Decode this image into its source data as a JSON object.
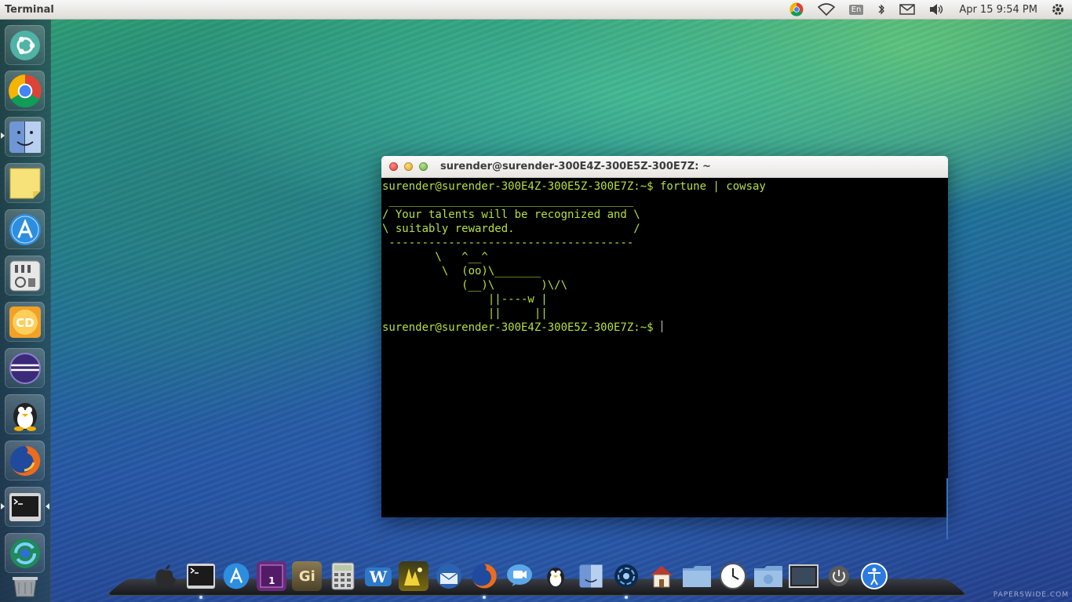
{
  "top_panel": {
    "app_title": "Terminal",
    "keyboard_layout": "En",
    "clock": "Apr 15  9:54 PM",
    "indicators": [
      "chrome-icon",
      "wifi-icon",
      "keyboard-layout",
      "bluetooth-icon",
      "mail-icon",
      "volume-icon",
      "clock",
      "power-gear-icon"
    ]
  },
  "launcher": {
    "items": [
      "ubuntu-dash",
      "google-chrome",
      "finder",
      "sticky-notes",
      "app-store",
      "system-settings",
      "cd-burner",
      "eclipse",
      "penguin-app",
      "firefox",
      "terminal",
      "refresh-app",
      "trash"
    ]
  },
  "terminal": {
    "title": "surender@surender-300E4Z-300E5Z-300E7Z: ~",
    "lines": [
      "surender@surender-300E4Z-300E5Z-300E7Z:~$ fortune | cowsay",
      " _____________________________________",
      "/ Your talents will be recognized and \\",
      "\\ suitably rewarded.                  /",
      " -------------------------------------",
      "        \\   ^__^",
      "         \\  (oo)\\_______",
      "            (__)\\       )\\/\\",
      "                ||----w |",
      "                ||     ||",
      "surender@surender-300E4Z-300E5Z-300E7Z:~$ "
    ]
  },
  "dock": {
    "items": [
      "apple",
      "terminal",
      "app-store",
      "workspace-1",
      "gimp",
      "calculator",
      "wordpress",
      "photo-app",
      "thunderbird",
      "firefox",
      "facetime",
      "penguin-app",
      "finder",
      "swirl-app",
      "home",
      "documents",
      "clock",
      "downloads",
      "screen",
      "power",
      "accessibility"
    ],
    "workspace_label": "1",
    "gimp_label": "Gi"
  },
  "watermark": "PAPERSWIDE.COM",
  "colors": {
    "terminal_text": "#b6e03d",
    "panel_bg": "#e9e8e4",
    "launcher_bg": "#23414b"
  }
}
